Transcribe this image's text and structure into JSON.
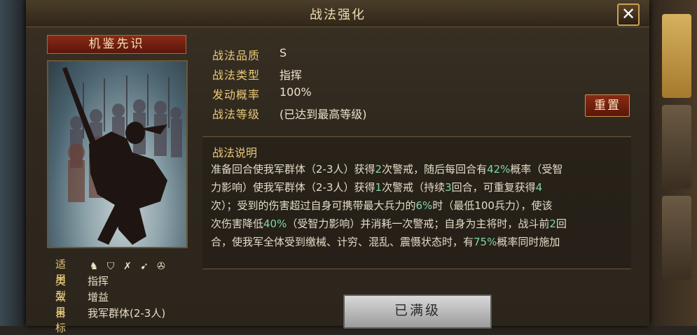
{
  "dialog": {
    "title": "战法强化",
    "close_label": "✕"
  },
  "card": {
    "name": "机鉴先识"
  },
  "attributes": [
    {
      "label": "适用",
      "value": ""
    },
    {
      "label": "类型",
      "value": "指挥"
    },
    {
      "label": "效果",
      "value": "增益"
    },
    {
      "label": "目标",
      "value": "我军群体(2-3人)"
    }
  ],
  "applicable_icons": [
    "cavalry-icon",
    "shield-icon",
    "bow-icon",
    "spear-icon",
    "wheel-icon"
  ],
  "properties": [
    {
      "label": "战法品质",
      "value": "S"
    },
    {
      "label": "战法类型",
      "value": "指挥"
    },
    {
      "label": "发动概率",
      "value": "100%"
    },
    {
      "label": "战法等级",
      "value": "(已达到最高等级)"
    }
  ],
  "reset_label": "重置",
  "description": {
    "title": "战法说明",
    "lines": [
      [
        {
          "t": "准备回合使我军群体（2-3人）获得"
        },
        {
          "t": "2",
          "hl": true
        },
        {
          "t": "次警戒，随后每回合有"
        },
        {
          "t": "42%",
          "hl": true
        },
        {
          "t": "概率（受智"
        }
      ],
      [
        {
          "t": "力影响）使我军群体（2-3人）获得"
        },
        {
          "t": "1",
          "hl": true
        },
        {
          "t": "次警戒（持续"
        },
        {
          "t": "3",
          "hl": true
        },
        {
          "t": "回合，可重复获得"
        },
        {
          "t": "4",
          "hl": true
        }
      ],
      [
        {
          "t": "次）；受到的伤害超过自身可携带最大兵力的"
        },
        {
          "t": "6%",
          "hl": true
        },
        {
          "t": "时（最低100兵力），使该"
        }
      ],
      [
        {
          "t": "次伤害降低"
        },
        {
          "t": "40%",
          "hl": true
        },
        {
          "t": "（受智力影响）并消耗一次警戒；自身为主将时，战斗前"
        },
        {
          "t": "2",
          "hl": true
        },
        {
          "t": "回"
        }
      ],
      [
        {
          "t": "合，使我军全体受到缴械、计穷、混乱、震慑状态时，有"
        },
        {
          "t": "75%",
          "hl": true
        },
        {
          "t": "概率同时施加"
        }
      ]
    ]
  },
  "max_level_label": "已满级"
}
